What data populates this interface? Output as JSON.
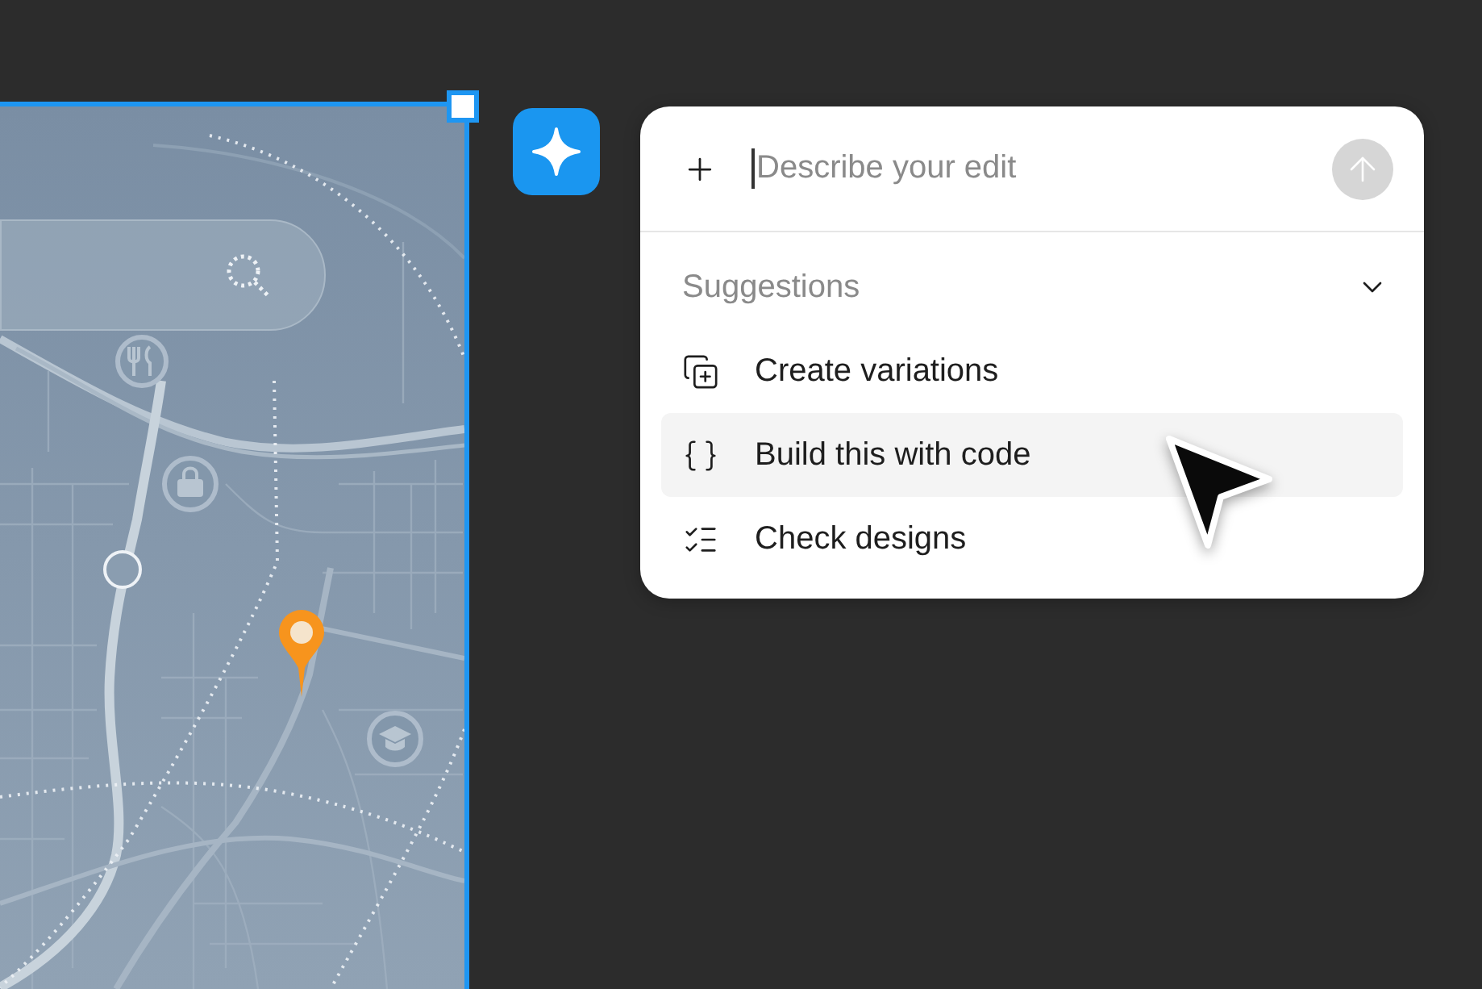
{
  "canvas_frame": {
    "selected": true
  },
  "edit_prompt": {
    "placeholder": "Describe your edit",
    "focused": true,
    "send_disabled": true
  },
  "suggestions": {
    "title": "Suggestions",
    "expanded": true,
    "items": [
      {
        "kind": "variations",
        "label": "Create variations",
        "highlighted": false
      },
      {
        "kind": "code",
        "label": "Build this with code",
        "highlighted": true
      },
      {
        "kind": "checklist",
        "label": "Check designs",
        "highlighted": false
      }
    ]
  }
}
